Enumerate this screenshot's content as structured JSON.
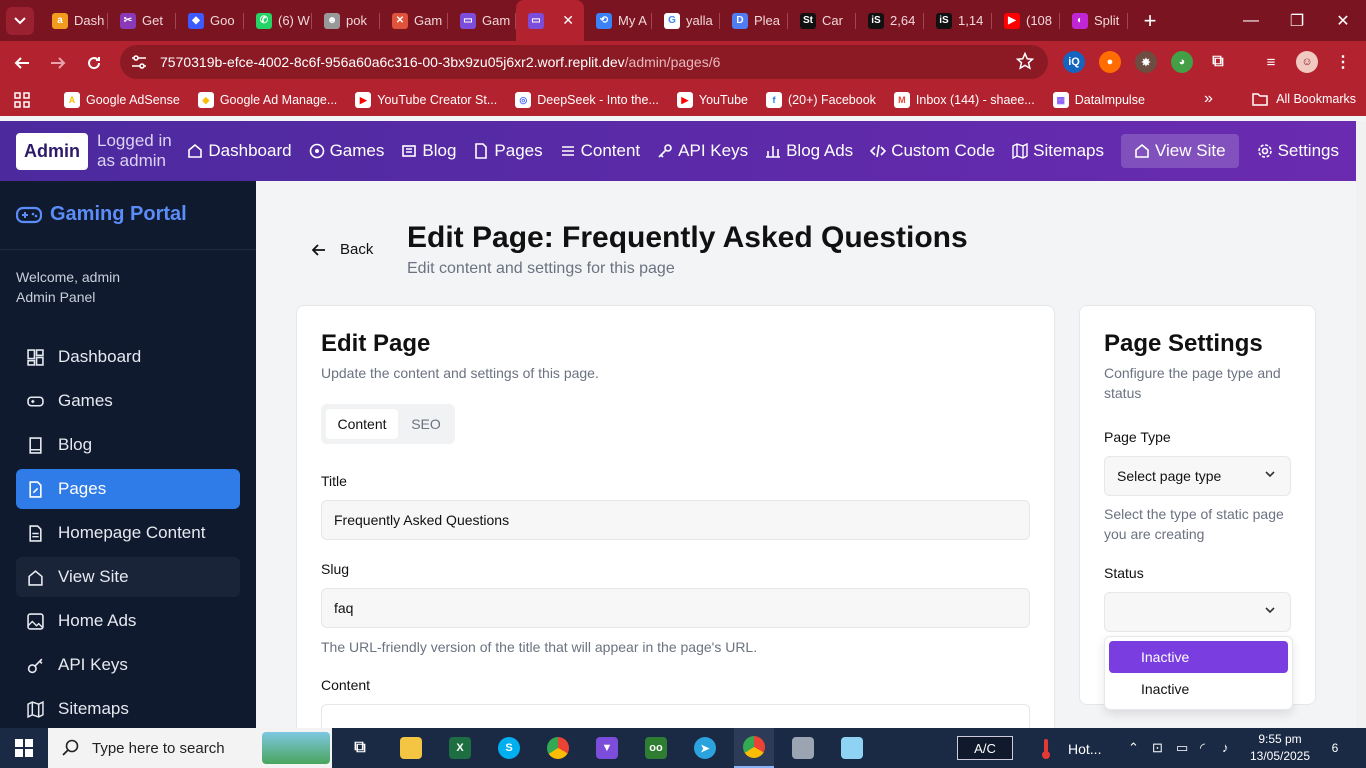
{
  "browser": {
    "tabs": [
      {
        "title": "Dash",
        "fav_color": "#f29b1f",
        "fav_text": "a"
      },
      {
        "title": "Get",
        "fav_color": "#8a3ab9",
        "fav_text": "✂"
      },
      {
        "title": "Goo",
        "fav_color": "#3d5afe",
        "fav_text": "◆"
      },
      {
        "title": "(6) W",
        "fav_color": "#25d366",
        "fav_text": "✆"
      },
      {
        "title": "pok",
        "fav_color": "#999999",
        "fav_text": "☻"
      },
      {
        "title": "Gam",
        "fav_color": "#e0533a",
        "fav_text": "✕"
      },
      {
        "title": "Gam",
        "fav_color": "#7c4ddb",
        "fav_text": "▭"
      },
      {
        "title": "",
        "fav_color": "#7c4ddb",
        "fav_text": "▭",
        "active": true
      },
      {
        "title": "My A",
        "fav_color": "#3b82f6",
        "fav_text": "⟲"
      },
      {
        "title": "yalla",
        "fav_color": "#ffffff",
        "fav_text": "G"
      },
      {
        "title": "Plea",
        "fav_color": "#4f7df3",
        "fav_text": "D"
      },
      {
        "title": "Car",
        "fav_color": "#111111",
        "fav_text": "St"
      },
      {
        "title": "2,64",
        "fav_color": "#111111",
        "fav_text": "iS"
      },
      {
        "title": "1,14",
        "fav_color": "#111111",
        "fav_text": "iS"
      },
      {
        "title": "(108",
        "fav_color": "#ff0000",
        "fav_text": "▶"
      },
      {
        "title": "Split",
        "fav_color": "#c026d3",
        "fav_text": "◐"
      }
    ],
    "url_host": "7570319b-efce-4002-8c6f-956a60a6c316-00-3bx9zu05j6xr2.worf.replit.dev",
    "url_path": "/admin/pages/6",
    "bookmarks": [
      {
        "label": "Google AdSense",
        "color": "#fbbc04",
        "glyph": "A"
      },
      {
        "label": "Google Ad Manage...",
        "color": "#fbbc04",
        "glyph": "◆"
      },
      {
        "label": "YouTube Creator St...",
        "color": "#ff0000",
        "glyph": "▶"
      },
      {
        "label": "DeepSeek - Into the...",
        "color": "#4d6bfe",
        "glyph": "◎"
      },
      {
        "label": "YouTube",
        "color": "#ff0000",
        "glyph": "▶"
      },
      {
        "label": "(20+) Facebook",
        "color": "#1877f2",
        "glyph": "f"
      },
      {
        "label": "Inbox (144) - shaee...",
        "color": "#ea4335",
        "glyph": "M"
      },
      {
        "label": "DataImpulse",
        "color": "#8b5cf6",
        "glyph": "▦"
      }
    ],
    "all_bookmarks": "All Bookmarks"
  },
  "topnav": {
    "badge": "Admin",
    "logged_in": "Logged in as admin",
    "items": [
      "Dashboard",
      "Games",
      "Blog",
      "Pages",
      "Content",
      "API Keys",
      "Blog Ads",
      "Custom Code",
      "Sitemaps",
      "View Site",
      "Settings"
    ]
  },
  "sidebar": {
    "brand": "Gaming Portal",
    "welcome": "Welcome, admin",
    "role": "Admin Panel",
    "items": [
      "Dashboard",
      "Games",
      "Blog",
      "Pages",
      "Homepage Content",
      "View Site",
      "Home Ads",
      "API Keys",
      "Sitemaps"
    ],
    "active": "Pages"
  },
  "main": {
    "back": "Back",
    "title": "Edit Page: Frequently Asked Questions",
    "subtitle": "Edit content and settings for this page",
    "edit_card": {
      "title": "Edit Page",
      "description": "Update the content and settings of this page.",
      "tabs": [
        "Content",
        "SEO"
      ],
      "title_label": "Title",
      "title_value": "Frequently Asked Questions",
      "slug_label": "Slug",
      "slug_value": "faq",
      "slug_help": "The URL-friendly version of the title that will appear in the page's URL.",
      "content_label": "Content"
    },
    "settings_card": {
      "title": "Page Settings",
      "description": "Configure the page type and status",
      "type_label": "Page Type",
      "type_placeholder": "Select page type",
      "type_help": "Select the type of static page you are creating",
      "status_label": "Status",
      "status_value": "",
      "status_options": [
        "Inactive",
        "Inactive"
      ]
    }
  },
  "taskbar": {
    "search_placeholder": "Type here to search",
    "ac_label": "A/C",
    "weather": "Hot...",
    "time": "9:55 pm",
    "date": "13/05/2025",
    "notifications": "6"
  },
  "colors": {
    "chrome": "#b3222f",
    "admin_gradient_start": "#4c2a9e",
    "sidebar_bg": "#0f1a2e",
    "active_blue": "#2f7be8",
    "option_purple": "#7a3ee0"
  }
}
